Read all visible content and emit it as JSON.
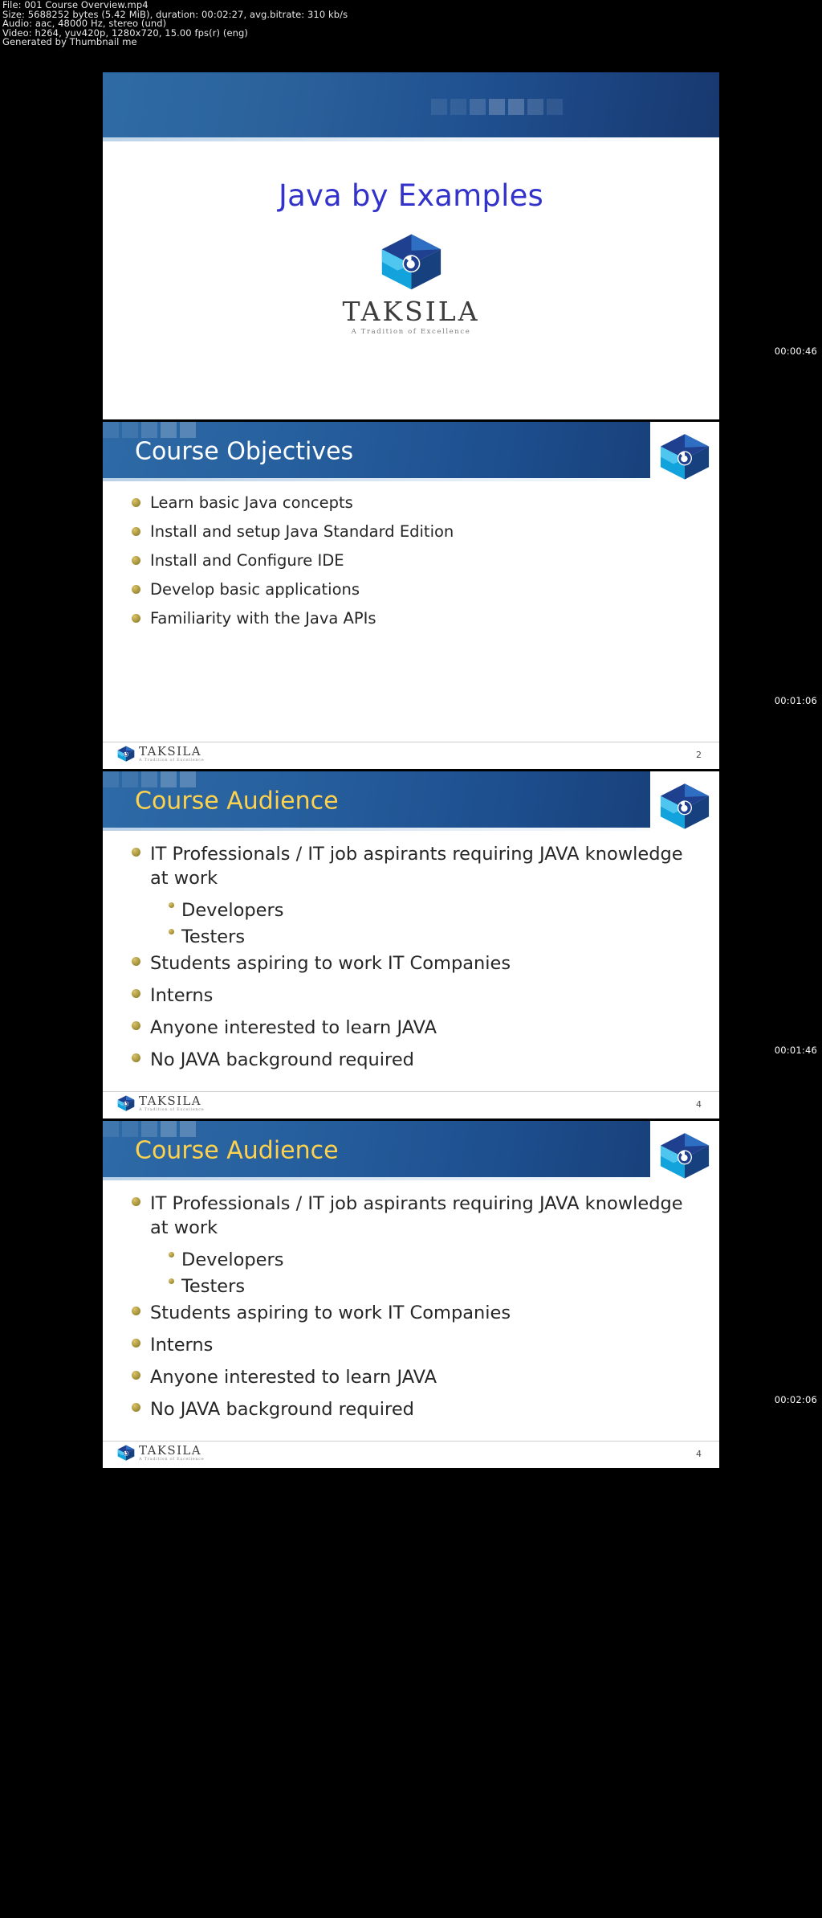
{
  "meta": {
    "lines": [
      "File: 001 Course Overview.mp4",
      "Size: 5688252 bytes (5.42 MiB), duration: 00:02:27, avg.bitrate: 310 kb/s",
      "Audio: aac, 48000 Hz, stereo (und)",
      "Video: h264, yuv420p, 1280x720, 15.00 fps(r) (eng)",
      "Generated by Thumbnail me"
    ]
  },
  "brand": {
    "wordmark": "TAKSILA",
    "tagline": "A Tradition of Excellence",
    "accent_blue": "#1d4e8e",
    "accent_gold": "#ffd24d",
    "title_purple": "#3333cc"
  },
  "frames": [
    {
      "timestamp": "00:00:46",
      "kind": "title",
      "title": "Java by Examples"
    },
    {
      "timestamp": "00:01:06",
      "kind": "content",
      "title": "Course Objectives",
      "title_color": "white",
      "page_number": "2",
      "bullets": [
        {
          "text": "Learn basic Java concepts"
        },
        {
          "text": "Install and setup Java Standard Edition"
        },
        {
          "text": "Install and Configure IDE"
        },
        {
          "text": "Develop basic applications"
        },
        {
          "text": "Familiarity with the Java APIs"
        }
      ]
    },
    {
      "timestamp": "00:01:46",
      "kind": "content",
      "title": "Course Audience",
      "title_color": "gold",
      "page_number": "4",
      "bullets": [
        {
          "text": "IT Professionals / IT job aspirants requiring JAVA knowledge at work",
          "sub": [
            "Developers",
            "Testers"
          ]
        },
        {
          "text": "Students aspiring to work IT Companies"
        },
        {
          "text": "Interns"
        },
        {
          "text": "Anyone interested to learn JAVA"
        },
        {
          "text": "No JAVA background required"
        }
      ]
    },
    {
      "timestamp": "00:02:06",
      "kind": "content",
      "title": "Course Audience",
      "title_color": "gold",
      "page_number": "4",
      "bullets": [
        {
          "text": "IT Professionals / IT job aspirants requiring JAVA knowledge at work",
          "sub": [
            "Developers",
            "Testers"
          ]
        },
        {
          "text": "Students aspiring to work IT Companies"
        },
        {
          "text": "Interns"
        },
        {
          "text": "Anyone interested to learn JAVA"
        },
        {
          "text": "No JAVA background required"
        }
      ]
    }
  ]
}
